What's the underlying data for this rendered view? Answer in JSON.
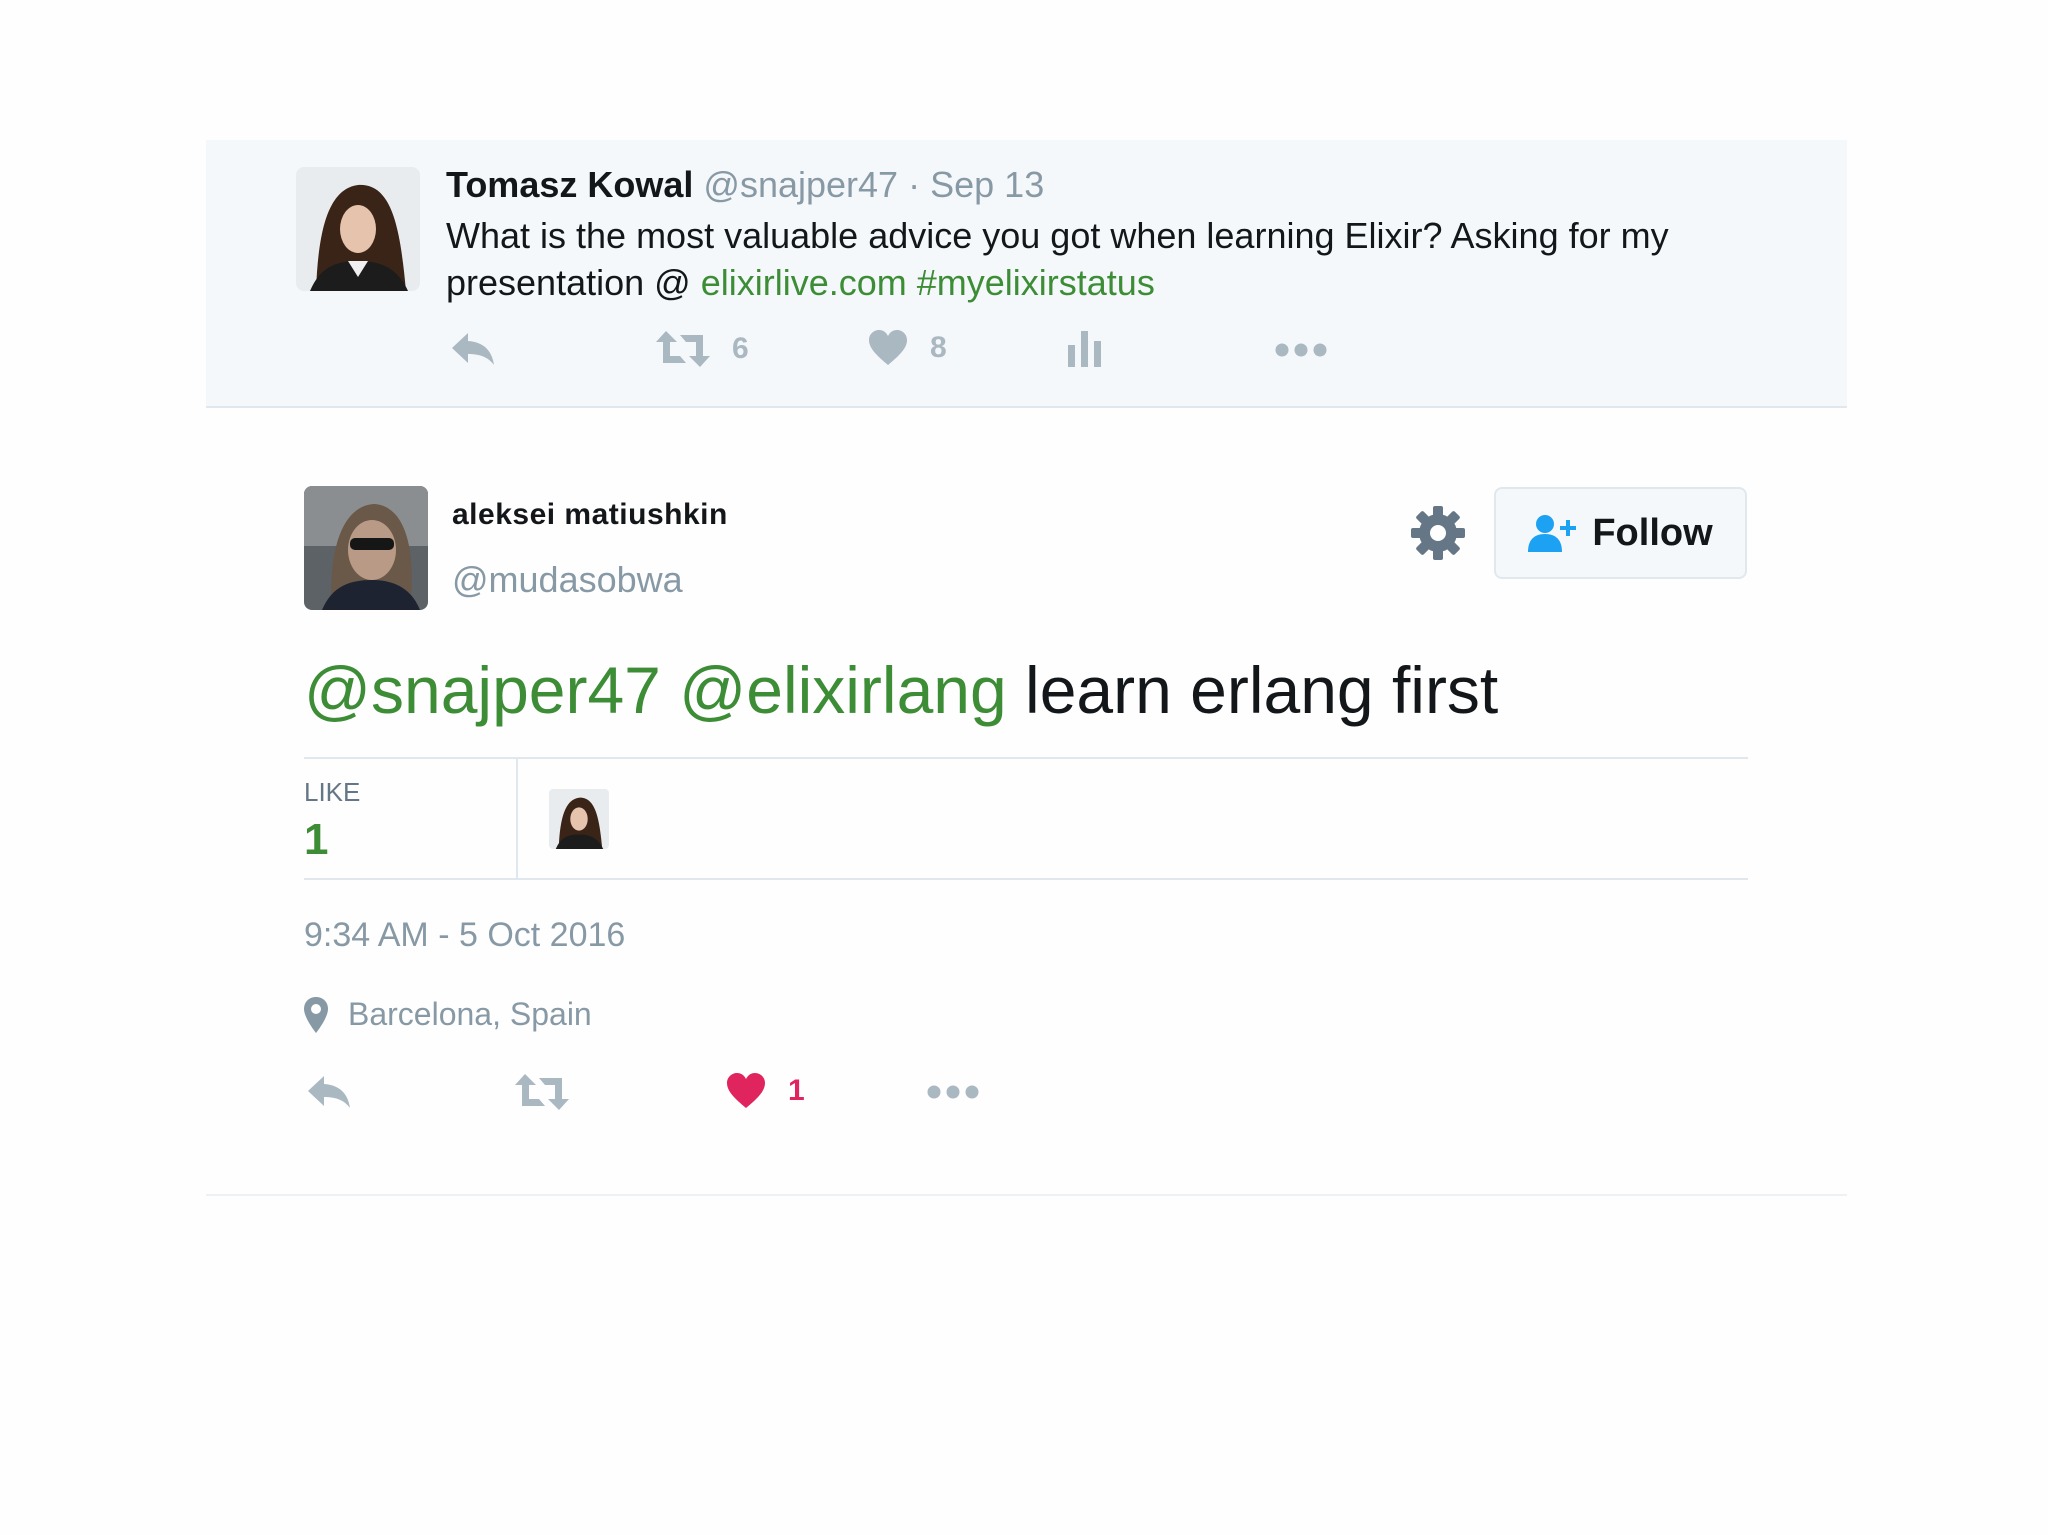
{
  "parent_tweet": {
    "author_name": "Tomasz Kowal",
    "author_handle": "@snajper47",
    "separator": "·",
    "date": "Sep 13",
    "text_plain": "What is the most valuable advice you got when learning Elixir? Asking for my presentation @",
    "link": "elixirlive.com",
    "hashtag": "#myelixirstatus",
    "retweet_count": "6",
    "like_count": "8",
    "icons": [
      "reply-icon",
      "retweet-icon",
      "heart-icon",
      "analytics-icon",
      "more-icon"
    ]
  },
  "main_tweet": {
    "author_name": "aleksei matiushkin",
    "author_handle": "@mudasobwa",
    "follow_label": "Follow",
    "mention_1": "@snajper47",
    "mention_2": "@elixirlang",
    "text_plain": "learn erlang first",
    "like_label": "LIKE",
    "like_stat": "1",
    "timestamp": "9:34 AM - 5 Oct 2016",
    "location": "Barcelona, Spain",
    "action_like_count": "1",
    "icons": [
      "gear-icon",
      "follow-user-icon",
      "location-pin-icon",
      "reply-icon",
      "retweet-icon",
      "heart-icon",
      "more-icon"
    ]
  },
  "colors": {
    "link_green": "#3d8c36",
    "muted": "#8899a6",
    "heart_red": "#e0245e",
    "follow_blue": "#1da1f2",
    "parent_bg": "#f5f8fa"
  }
}
